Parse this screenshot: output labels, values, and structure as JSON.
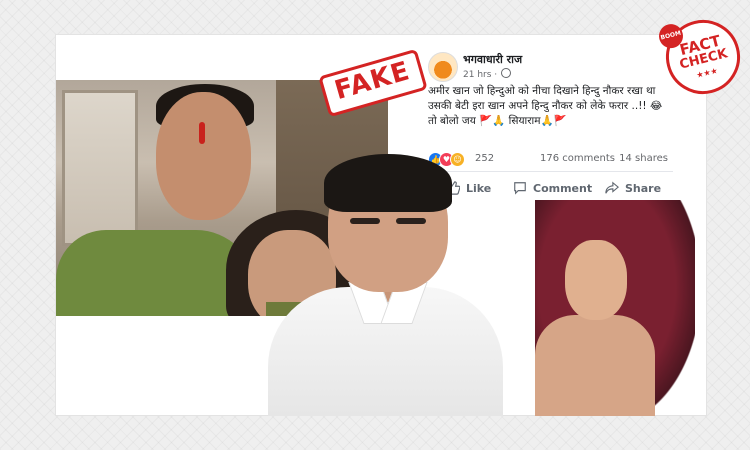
{
  "post": {
    "author": "भगवाधारी राज",
    "time": "21 hrs ·",
    "text": "अमीर खान जो हिन्दुओ को नीचा दिखाने हिन्दु नौकर रखा था उसकी बेटी इरा खान अपने हिन्दु नौकर को लेके फरार ..!! 😂 तो बोलो जय 🚩🙏 सियाराम🙏🚩",
    "reactions_count": "252",
    "comments": "176 comments",
    "shares": "14 shares",
    "actions": {
      "like": "Like",
      "comment": "Comment",
      "share": "Share"
    }
  },
  "stamps": {
    "fake": "FAKE",
    "fact_check_brand": "BOOM",
    "fact_check_line1": "FACT",
    "fact_check_line2": "CHECK",
    "fact_check_stars": "★★★"
  },
  "colors": {
    "stamp_red": "#d42323",
    "fb_text": "#1c1e21",
    "fb_muted": "#65676b",
    "like_blue": "#1877f2",
    "love_red": "#f33e58",
    "haha_yellow": "#f7b125"
  },
  "icons": [
    "like-icon",
    "comment-icon",
    "share-icon",
    "globe-icon"
  ]
}
